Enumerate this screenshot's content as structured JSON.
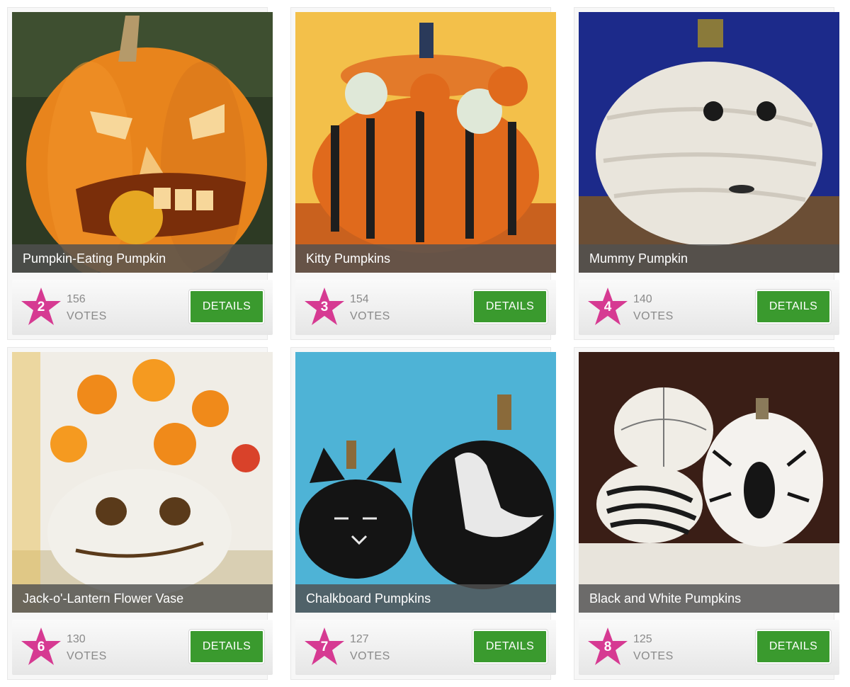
{
  "cards": [
    {
      "title": "Pumpkin-Eating Pumpkin",
      "rank": "2",
      "votes": "156",
      "votes_label": "VOTES",
      "button": "DETAILS"
    },
    {
      "title": "Kitty Pumpkins",
      "rank": "3",
      "votes": "154",
      "votes_label": "VOTES",
      "button": "DETAILS"
    },
    {
      "title": "Mummy Pumpkin",
      "rank": "4",
      "votes": "140",
      "votes_label": "VOTES",
      "button": "DETAILS"
    },
    {
      "title": "Jack-o'-Lantern Flower Vase",
      "rank": "6",
      "votes": "130",
      "votes_label": "VOTES",
      "button": "DETAILS"
    },
    {
      "title": "Chalkboard Pumpkins",
      "rank": "7",
      "votes": "127",
      "votes_label": "VOTES",
      "button": "DETAILS"
    },
    {
      "title": "Black and White Pumpkins",
      "rank": "8",
      "votes": "125",
      "votes_label": "VOTES",
      "button": "DETAILS"
    }
  ],
  "colors": {
    "star": "#d63a92",
    "button": "#3a9a2e",
    "caption_bg": "#505050"
  }
}
